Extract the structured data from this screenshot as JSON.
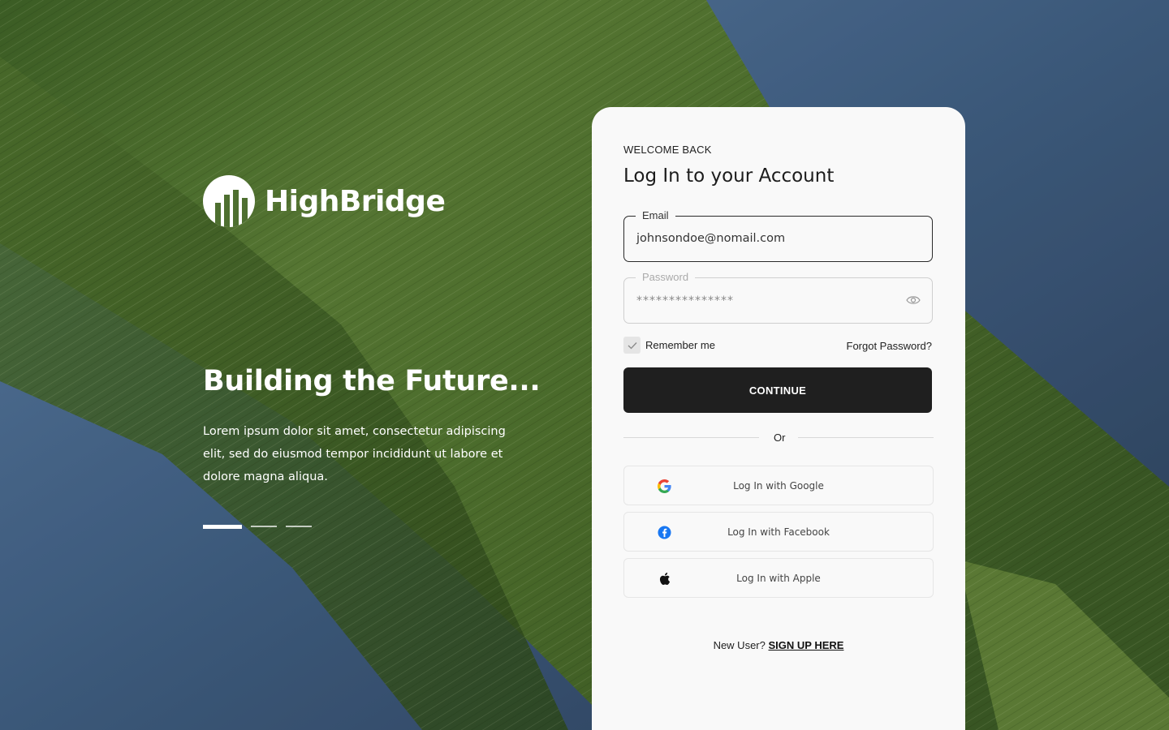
{
  "brand": {
    "name": "HighBridge"
  },
  "hero": {
    "title": "Building the Future...",
    "text": "Lorem ipsum dolor sit amet, consectetur adipiscing elit, sed do eiusmod tempor incididunt ut labore et dolore magna aliqua.",
    "carousel": {
      "count": 3,
      "active": 1
    }
  },
  "login": {
    "eyebrow": "WELCOME BACK",
    "title": "Log In to your Account",
    "email": {
      "label": "Email",
      "value": "johnsondoe@nomail.com"
    },
    "password": {
      "label": "Password",
      "value": "***************"
    },
    "remember": {
      "label": "Remember me",
      "checked": true
    },
    "forgot_label": "Forgot Password?",
    "continue_label": "CONTINUE",
    "or_label": "Or",
    "social": [
      {
        "label": "Log In with Google",
        "icon": "google-icon"
      },
      {
        "label": "Log In with Facebook",
        "icon": "facebook-icon"
      },
      {
        "label": "Log In with Apple",
        "icon": "apple-icon"
      }
    ],
    "signup": {
      "prompt": "New User?",
      "link": "SIGN UP HERE"
    }
  },
  "colors": {
    "leaf": "#4a6b2e",
    "sky": "#3e5a7c",
    "card": "#f9f9f9",
    "button": "#1f1f1f"
  }
}
